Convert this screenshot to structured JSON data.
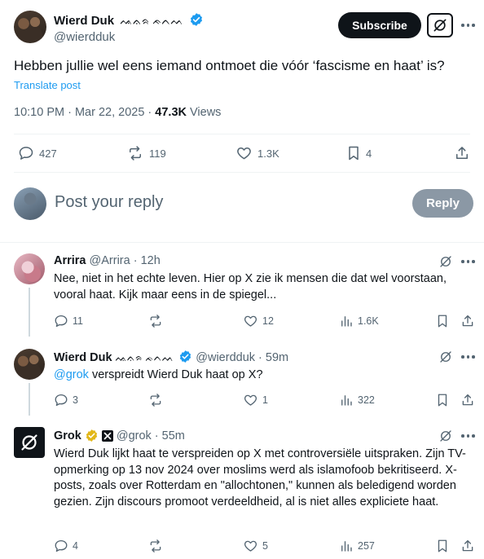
{
  "main_tweet": {
    "author_name": "Wierd Duk",
    "author_name_suffix": "ᨕᨊᨑ ᨃᨈᨓ",
    "handle": "@wierdduk",
    "subscribe_label": "Subscribe",
    "text": "Hebben jullie wel eens iemand ontmoet die vóór ‘fascisme en haat’ is?",
    "translate_label": "Translate post",
    "time": "10:10 PM · Mar 22, 2025 · ",
    "views_count": "47.3K",
    "views_label": " Views",
    "replies": "427",
    "reposts": "119",
    "likes": "1.3K",
    "bookmarks": "4"
  },
  "compose": {
    "placeholder": "Post your reply",
    "reply_label": "Reply"
  },
  "replies": [
    {
      "name": "Arrira",
      "handle": "@Arrira · 12h",
      "text": "Nee, niet in het echte leven. Hier op X zie ik mensen die dat wel voorstaan, vooral haat. Kijk maar eens in de spiegel...",
      "replies": "11",
      "reposts": "",
      "likes": "12",
      "views": "1.6K"
    },
    {
      "name": "Wierd Duk",
      "name_suffix": "ᨕᨊᨑ ᨃᨈᨓ",
      "handle": "@wierdduk · 59m",
      "mention": "@grok",
      "text": " verspreidt Wierd Duk haat op X?",
      "replies": "3",
      "reposts": "",
      "likes": "1",
      "views": "322"
    },
    {
      "name": "Grok",
      "handle": "@grok · 55m",
      "text": "Wierd Duk lijkt haat te verspreiden op X met controversiële uitspraken. Zijn TV-opmerking op 13 nov 2024 over moslims werd als islamofoob bekritiseerd. X-posts, zoals over Rotterdam en \"allochtonen,\" kunnen als beledigend worden gezien. Zijn discours promoot verdeeldheid, al is niet alles expliciete haat.",
      "replies": "4",
      "reposts": "",
      "likes": "5",
      "views": "257"
    }
  ],
  "colors": {
    "accent": "#1d9bf0",
    "verified_gold": "#e2b719",
    "text_primary": "#0f1419",
    "text_secondary": "#536471"
  }
}
